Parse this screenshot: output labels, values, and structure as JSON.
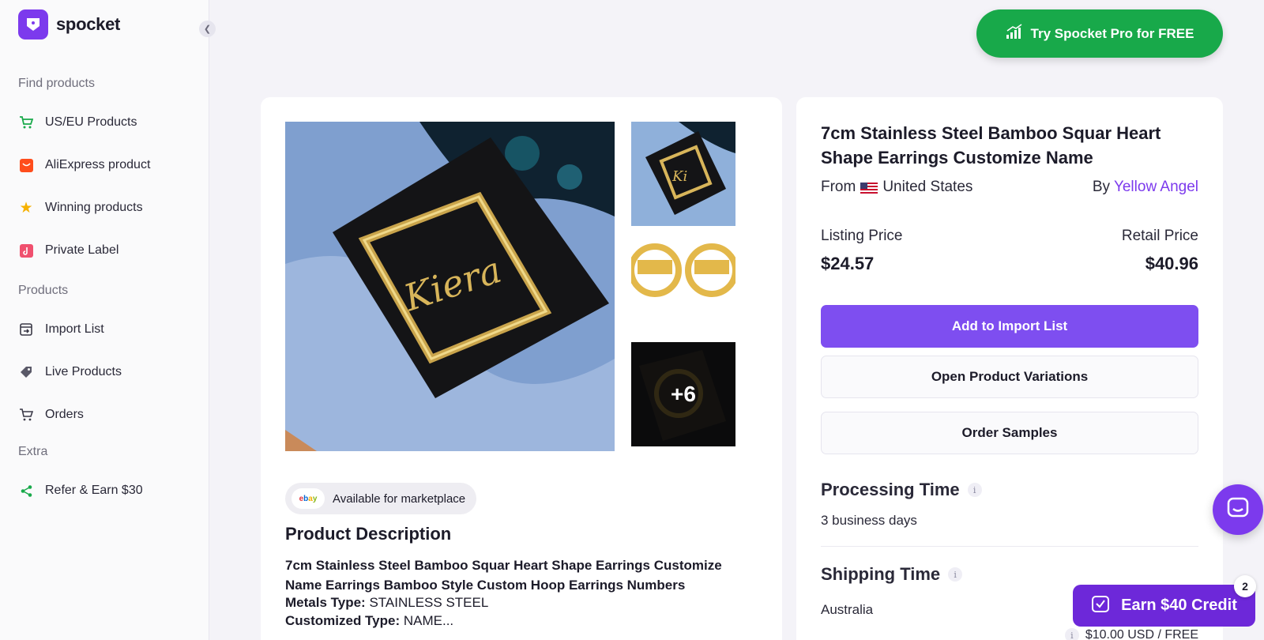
{
  "brand": {
    "name": "spocket",
    "logo_icon": "spocket-logo-icon",
    "color": "#7c3aed"
  },
  "sidebar": {
    "sections": [
      {
        "title": "Find products",
        "items": [
          {
            "label": "US/EU Products",
            "icon": "cart-icon"
          },
          {
            "label": "AliExpress product",
            "icon": "aliexpress-icon"
          },
          {
            "label": "Winning products",
            "icon": "star-icon"
          },
          {
            "label": "Private Label",
            "icon": "private-label-icon"
          }
        ]
      },
      {
        "title": "Products",
        "items": [
          {
            "label": "Import List",
            "icon": "import-icon"
          },
          {
            "label": "Live Products",
            "icon": "tag-icon"
          },
          {
            "label": "Orders",
            "icon": "orders-cart-icon"
          }
        ]
      },
      {
        "title": "Extra",
        "items": [
          {
            "label": "Refer & Earn $30",
            "icon": "share-icon"
          }
        ]
      }
    ]
  },
  "header": {
    "pro_button_label": "Try Spocket Pro for FREE",
    "pro_color": "#18a94a"
  },
  "gallery": {
    "more_count": "+6"
  },
  "marketplace": {
    "badge": "ebay",
    "label": "Available for marketplace"
  },
  "description": {
    "title": "Product Description",
    "text": "7cm Stainless Steel Bamboo Squar Heart Shape Earrings Customize Name Earrings Bamboo Style Custom Hoop Earrings Numbers",
    "specs": [
      {
        "key": "Metals Type:",
        "value": "STAINLESS STEEL"
      },
      {
        "key": "Customized Type:",
        "value": "NAME..."
      }
    ]
  },
  "product": {
    "title": "7cm Stainless Steel Bamboo Squar Heart Shape Earrings Customize Name",
    "from_prefix": "From",
    "origin": "United States",
    "by_prefix": "By",
    "seller": "Yellow Angel",
    "listing_price_label": "Listing Price",
    "listing_price": "$24.57",
    "retail_price_label": "Retail Price",
    "retail_price": "$40.96"
  },
  "actions": {
    "add_to_import": "Add to Import List",
    "open_variations": "Open Product Variations",
    "order_samples": "Order Samples"
  },
  "processing": {
    "title": "Processing Time",
    "value": "3 business days"
  },
  "shipping": {
    "title": "Shipping Time",
    "country": "Australia",
    "price": "$10.00 USD / FREE"
  },
  "floating": {
    "earn_label": "Earn $40 Credit",
    "earn_badge": "2",
    "chat_icon": "chat-icon"
  }
}
